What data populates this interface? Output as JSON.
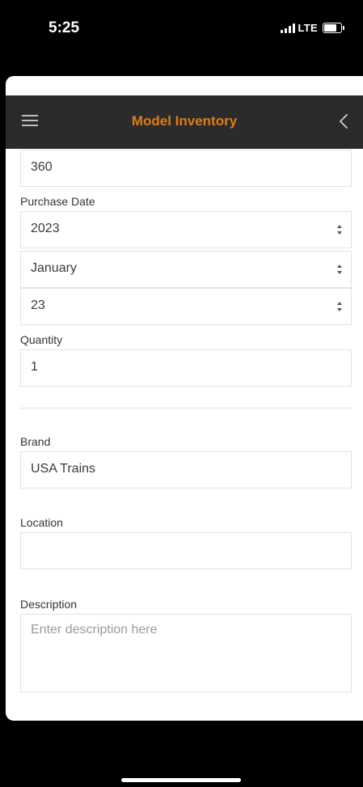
{
  "status_bar": {
    "time": "5:25",
    "network": "LTE"
  },
  "nav": {
    "title": "Model Inventory"
  },
  "form": {
    "top_value": "360",
    "purchase_date": {
      "label": "Purchase Date",
      "year": "2023",
      "month": "January",
      "day": "23"
    },
    "quantity": {
      "label": "Quantity",
      "value": "1"
    },
    "brand": {
      "label": "Brand",
      "value": "USA Trains"
    },
    "location": {
      "label": "Location",
      "value": ""
    },
    "description": {
      "label": "Description",
      "placeholder": "Enter description here"
    }
  }
}
